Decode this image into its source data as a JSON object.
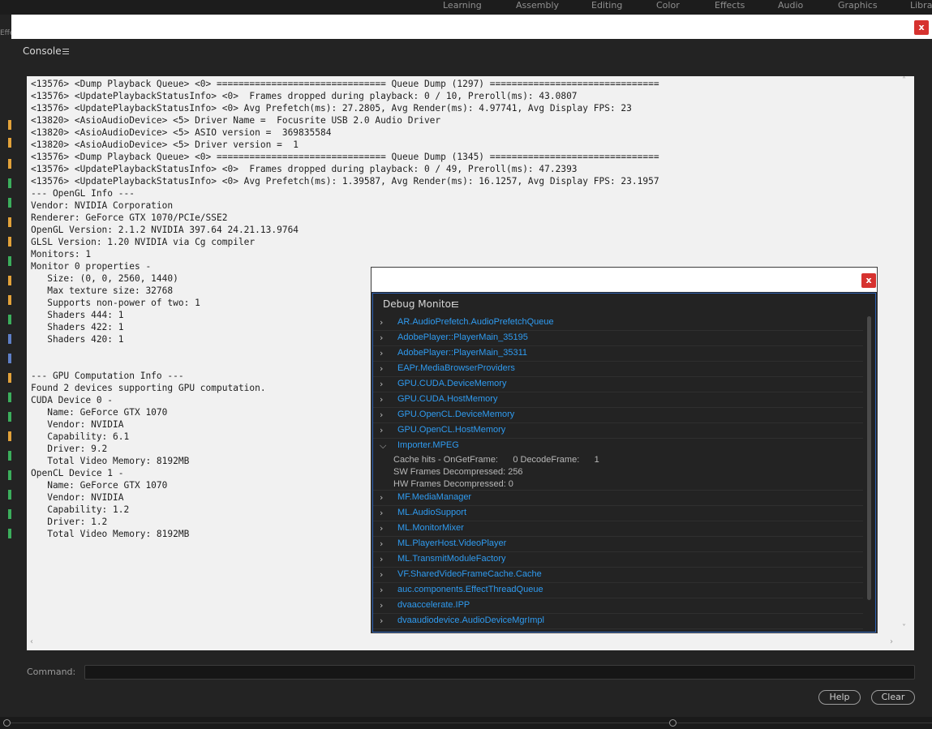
{
  "workspace_tabs": [
    "Learning",
    "Assembly",
    "Editing",
    "Color",
    "Effects",
    "Audio",
    "Graphics",
    "Librar"
  ],
  "left_panel_label": "Effe",
  "console": {
    "close_label": "x",
    "title": "Console",
    "log_lines": [
      "<13576> <Dump Playback Queue> <0> =============================== Queue Dump (1297) ===============================",
      "<13576> <UpdatePlaybackStatusInfo> <0>  Frames dropped during playback: 0 / 10, Preroll(ms): 43.0807",
      "<13576> <UpdatePlaybackStatusInfo> <0> Avg Prefetch(ms): 27.2805, Avg Render(ms): 4.97741, Avg Display FPS: 23",
      "<13820> <AsioAudioDevice> <5> Driver Name =  Focusrite USB 2.0 Audio Driver",
      "<13820> <AsioAudioDevice> <5> ASIO version =  369835584",
      "<13820> <AsioAudioDevice> <5> Driver version =  1",
      "<13576> <Dump Playback Queue> <0> =============================== Queue Dump (1345) ===============================",
      "<13576> <UpdatePlaybackStatusInfo> <0>  Frames dropped during playback: 0 / 49, Preroll(ms): 47.2393",
      "<13576> <UpdatePlaybackStatusInfo> <0> Avg Prefetch(ms): 1.39587, Avg Render(ms): 16.1257, Avg Display FPS: 23.1957",
      "--- OpenGL Info ---",
      "Vendor: NVIDIA Corporation",
      "Renderer: GeForce GTX 1070/PCIe/SSE2",
      "OpenGL Version: 2.1.2 NVIDIA 397.64 24.21.13.9764",
      "GLSL Version: 1.20 NVIDIA via Cg compiler",
      "Monitors: 1",
      "Monitor 0 properties -",
      "   Size: (0, 0, 2560, 1440)",
      "   Max texture size: 32768",
      "   Supports non-power of two: 1",
      "   Shaders 444: 1",
      "   Shaders 422: 1",
      "   Shaders 420: 1",
      "",
      "",
      "--- GPU Computation Info ---",
      "Found 2 devices supporting GPU computation.",
      "CUDA Device 0 -",
      "   Name: GeForce GTX 1070",
      "   Vendor: NVIDIA",
      "   Capability: 6.1",
      "   Driver: 9.2",
      "   Total Video Memory: 8192MB",
      "OpenCL Device 1 -",
      "   Name: GeForce GTX 1070",
      "   Vendor: NVIDIA",
      "   Capability: 1.2",
      "   Driver: 1.2",
      "   Total Video Memory: 8192MB"
    ],
    "command_label": "Command:",
    "command_value": "",
    "help_label": "Help",
    "clear_label": "Clear"
  },
  "debug_monitor": {
    "close_label": "x",
    "title": "Debug Monitor",
    "items_before": [
      "AR.AudioPrefetch.AudioPrefetchQueue",
      "AdobePlayer::PlayerMain_35195",
      "AdobePlayer::PlayerMain_35311",
      "EAPr.MediaBrowserProviders",
      "GPU.CUDA.DeviceMemory",
      "GPU.CUDA.HostMemory",
      "GPU.OpenCL.DeviceMemory",
      "GPU.OpenCL.HostMemory"
    ],
    "expanded_item": {
      "label": "Importer.MPEG",
      "details": [
        "Cache hits - OnGetFrame:      0 DecodeFrame:      1",
        "SW Frames Decompressed: 256",
        "HW Frames Decompressed: 0"
      ]
    },
    "items_after": [
      "MF.MediaManager",
      "ML.AudioSupport",
      "ML.MonitorMixer",
      "ML.PlayerHost.VideoPlayer",
      "ML.TransmitModuleFactory",
      "VF.SharedVideoFrameCache.Cache",
      "auc.components.EffectThreadQueue",
      "dvaaccelerate.IPP",
      "dvaaudiodevice.AudioDeviceMgrImpl"
    ],
    "link_color": "#2f9bf0"
  }
}
